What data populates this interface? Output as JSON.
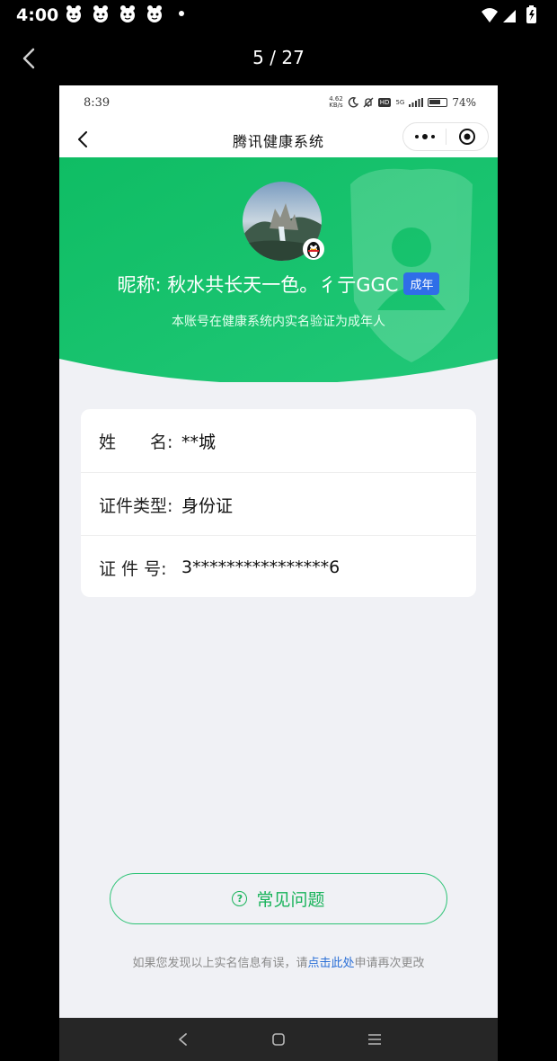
{
  "device": {
    "time": "4:00",
    "notification_icons": [
      "mascot-notification-icon",
      "mascot-notification-icon",
      "mascot-notification-icon",
      "mascot-notification-icon"
    ]
  },
  "viewer": {
    "counter": "5 / 27"
  },
  "inner_status": {
    "time": "8:39",
    "net_speed_value": "4.62",
    "net_speed_unit": "KB/s",
    "network": "5G",
    "hd": "HD",
    "battery_percent": "74%",
    "battery_level": 0.74
  },
  "navbar": {
    "title": "腾讯健康系统"
  },
  "profile": {
    "nickname": "昵称: 秋水共长天一色。彳亍GGC",
    "badge": "成年",
    "verify_text": "本账号在健康系统内实名验证为成年人"
  },
  "info": {
    "rows": [
      {
        "label": "姓　　名:",
        "value": "**城"
      },
      {
        "label": "证件类型:",
        "value": "身份证"
      },
      {
        "label": "证 件 号:",
        "value": "3****************6"
      }
    ]
  },
  "faq": {
    "icon_glyph": "?",
    "label": "常见问题"
  },
  "footnote": {
    "before": "如果您发现以上实名信息有误，请",
    "link": "点击此处",
    "after": "申请再次更改"
  },
  "colors": {
    "brand_green": "#18b35a",
    "hero_green": "#16c06a",
    "badge_blue": "#2f6ee8",
    "link_blue": "#2a6fd6"
  }
}
